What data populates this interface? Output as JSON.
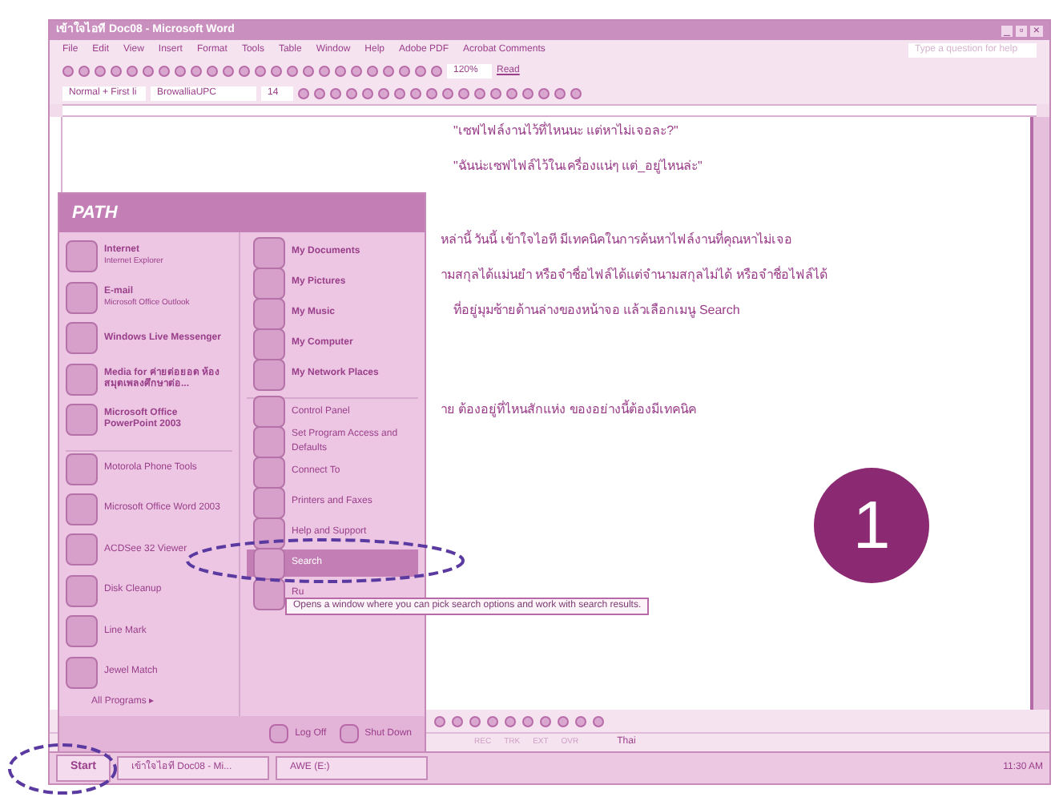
{
  "window": {
    "title": "เข้าใจไอที Doc08 - Microsoft Word",
    "controls": [
      "_",
      "▫",
      "×"
    ]
  },
  "menu_bar": {
    "items": [
      "File",
      "Edit",
      "View",
      "Insert",
      "Format",
      "Tools",
      "Table",
      "Window",
      "Help",
      "Adobe PDF",
      "Acrobat Comments"
    ],
    "help_placeholder": "Type a question for help"
  },
  "standard_toolbar": {
    "zoom": "120%",
    "read": "Read"
  },
  "formatting_toolbar": {
    "style": "Normal + First li",
    "font": "BrowalliaUPC",
    "size": "14"
  },
  "document": {
    "lines": [
      {
        "text": "\"เซฟไฟล์งานไว้ที่ไหนนะ แต่หาไม่เจอละ?\"",
        "indent": true
      },
      {
        "text": "\"ฉันน่ะเซฟไฟล์ไว้ในเครื่องแน่ๆ แต่_อยู่ไหนล่ะ\"",
        "indent": true
      },
      {
        "text": "หล่านี้ วันนี้ เข้าใจไอที มีเทคนิคในการค้นหาไฟล์งานที่คุณหาไม่เจอ",
        "indent": false
      },
      {
        "text": "ามสกุลได้แม่นยำ หรือจำชื่อไฟล์ได้แต่จำนามสกุลไม่ได้ หรือจำชื่อไฟล์ได้",
        "indent": false
      },
      {
        "text": "ที่อยู่มุมซ้ายด้านล่างของหน้าจอ แล้วเลือกเมนู Search",
        "indent": true
      },
      {
        "text": "าย ต้องอยู่ที่ไหนสักแห่ง ของอย่างนี้ต้องมีเทคนิค",
        "indent": false
      }
    ]
  },
  "start_menu": {
    "user": "PATH",
    "left_items": [
      {
        "title": "Internet",
        "subtitle": "Internet Explorer",
        "pinned": true
      },
      {
        "title": "E-mail",
        "subtitle": "Microsoft Office Outlook",
        "pinned": true
      },
      {
        "title": "Windows Live Messenger",
        "pinned": true
      },
      {
        "title": "Media for ค่ายต่อยอด ห้องสมุดเพลงศึกษาต่อ...",
        "pinned": true
      },
      {
        "title": "Microsoft Office PowerPoint 2003",
        "pinned": true
      },
      {
        "title": "Motorola Phone Tools",
        "pinned": false
      },
      {
        "title": "Microsoft Office Word 2003",
        "pinned": false
      },
      {
        "title": "ACDSee 32 Viewer",
        "pinned": false
      },
      {
        "title": "Disk Cleanup",
        "pinned": false
      },
      {
        "title": "Line Mark",
        "pinned": false
      },
      {
        "title": "Jewel Match",
        "pinned": false
      }
    ],
    "all_programs": "All Programs",
    "all_programs_arrow": "▸",
    "right_items": [
      {
        "label": "My Documents",
        "bold": true,
        "selected": false
      },
      {
        "label": "My Pictures",
        "bold": true,
        "selected": false
      },
      {
        "label": "My Music",
        "bold": true,
        "selected": false
      },
      {
        "label": "My Computer",
        "bold": true,
        "selected": false
      },
      {
        "label": "My Network Places",
        "bold": true,
        "selected": false
      },
      {
        "label": "Control Panel",
        "bold": false,
        "selected": false
      },
      {
        "label": "Set Program Access and Defaults",
        "bold": false,
        "selected": false
      },
      {
        "label": "Connect To",
        "bold": false,
        "selected": false
      },
      {
        "label": "Printers and Faxes",
        "bold": false,
        "selected": false
      },
      {
        "label": "Help and Support",
        "bold": false,
        "selected": false
      },
      {
        "label": "Search",
        "bold": false,
        "selected": true
      },
      {
        "label": "Ru",
        "bold": false,
        "selected": false
      }
    ],
    "tooltip": "Opens a window where you can pick search options and work with search results.",
    "log_off": "Log Off",
    "shut_down": "Shut Down"
  },
  "status_bar": {
    "modes": [
      "REC",
      "TRK",
      "EXT",
      "OVR"
    ],
    "language": "Thai"
  },
  "taskbar": {
    "start": "Start",
    "tasks": [
      "เข้าใจไอที Doc08 - Mi...",
      "AWE (E:)"
    ],
    "clock": "11:30 AM"
  },
  "step_badge": "1"
}
